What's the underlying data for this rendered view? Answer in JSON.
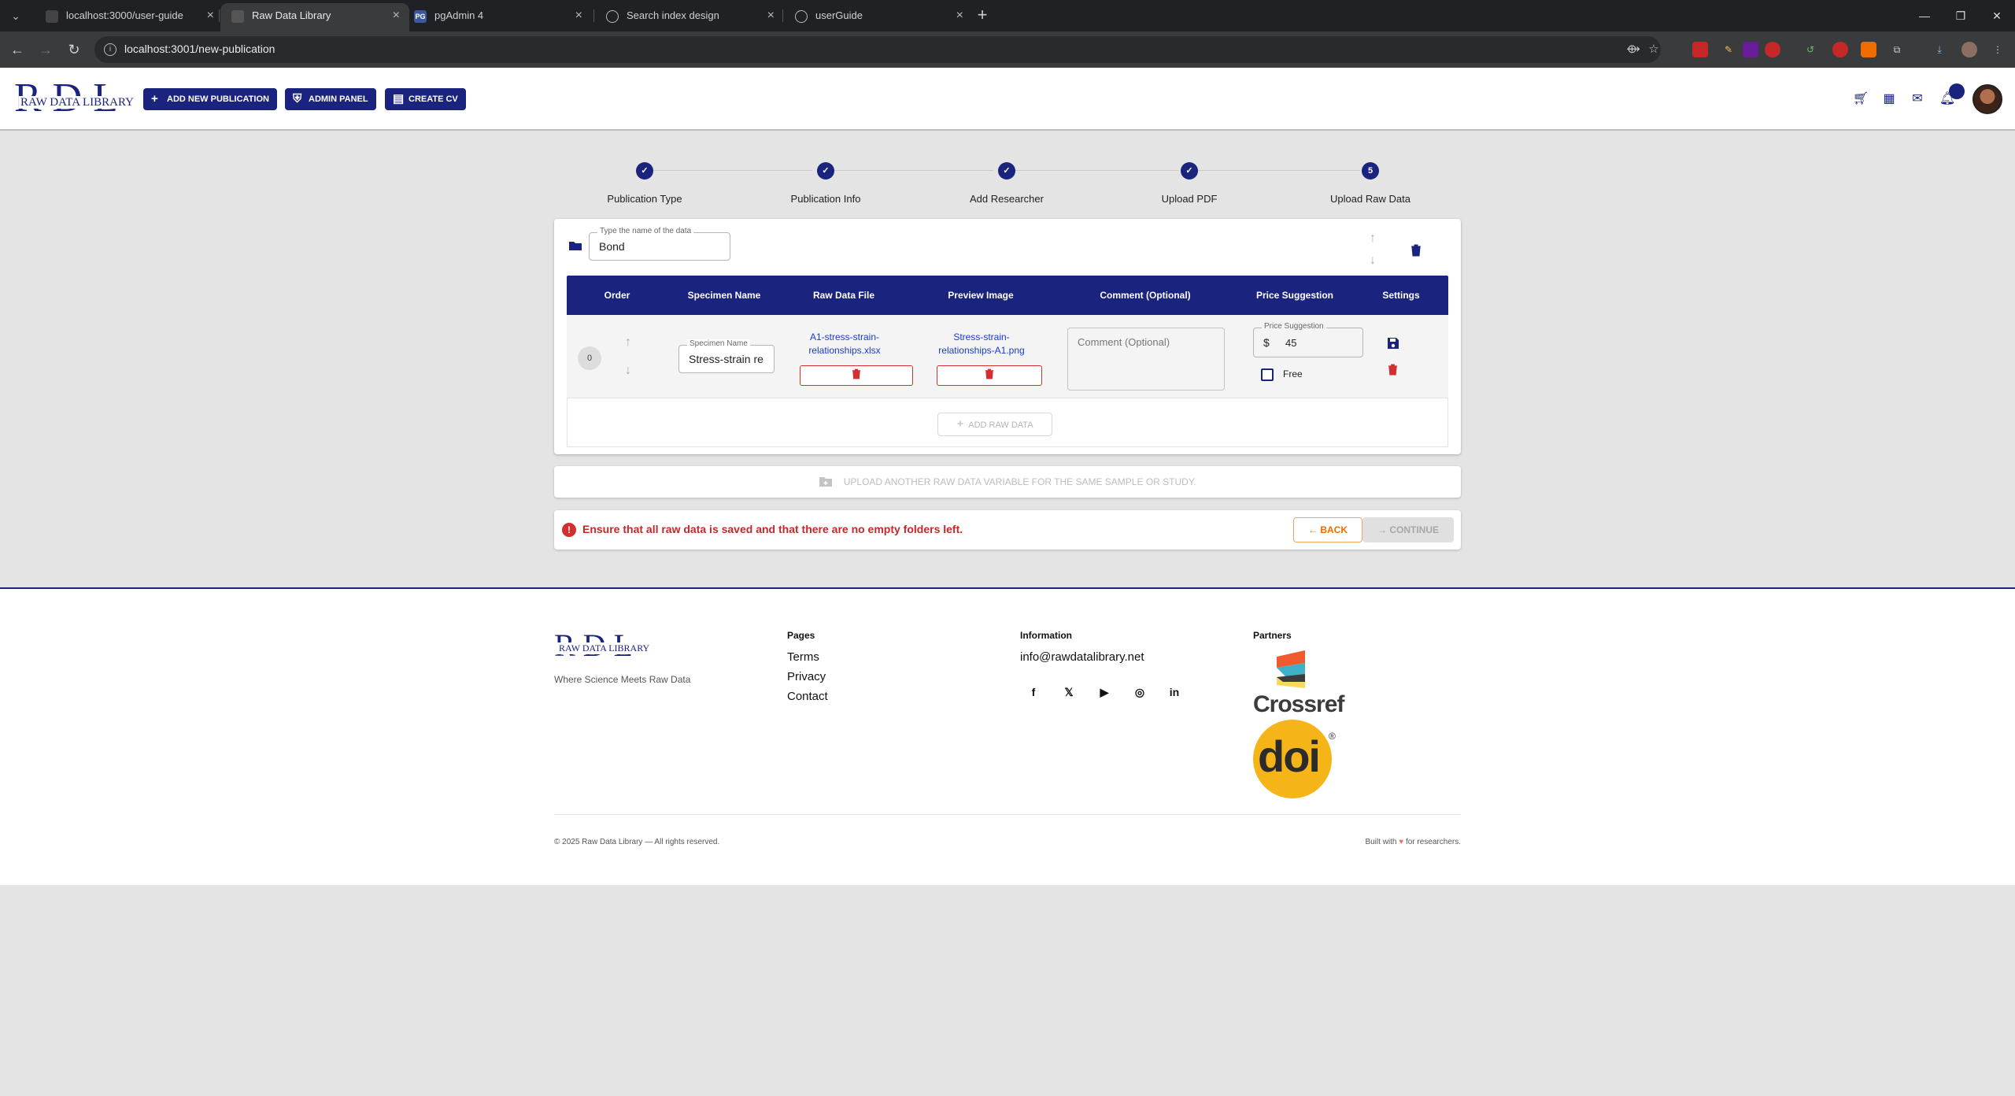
{
  "browser": {
    "tabs": [
      {
        "title": "localhost:3000/user-guide",
        "favicon_color": "#444"
      },
      {
        "title": "Raw Data Library",
        "favicon_color": "#555"
      },
      {
        "title": "pgAdmin 4",
        "favicon_color": "#3b5998"
      },
      {
        "title": "Search index design",
        "favicon_color": "#555"
      },
      {
        "title": "userGuide",
        "favicon_color": "#555"
      }
    ],
    "url": "localhost:3001/new-publication"
  },
  "header": {
    "logo_big": "RDL",
    "logo_small": "RAW DATA LIBRARY",
    "buttons": [
      {
        "label": "ADD NEW PUBLICATION",
        "icon": "plus-icon"
      },
      {
        "label": "ADMIN PANEL",
        "icon": "admin-shield-icon"
      },
      {
        "label": "CREATE CV",
        "icon": "cv-icon"
      }
    ]
  },
  "stepper": {
    "steps": [
      {
        "label": "Publication Type",
        "state": "done"
      },
      {
        "label": "Publication Info",
        "state": "done"
      },
      {
        "label": "Add Researcher",
        "state": "done"
      },
      {
        "label": "Upload PDF",
        "state": "done"
      },
      {
        "label": "Upload Raw Data",
        "state": "active",
        "number": "5"
      }
    ]
  },
  "folder": {
    "name_label": "Type the name of the data",
    "name_value": "Bond"
  },
  "table": {
    "headers": [
      "Order",
      "Specimen Name",
      "Raw Data File",
      "Preview Image",
      "Comment (Optional)",
      "Price Suggestion",
      "Settings"
    ],
    "row": {
      "order": "0",
      "specimen_label": "Specimen Name",
      "specimen_value": "Stress-strain re",
      "raw_file_line1": "A1-stress-strain-",
      "raw_file_line2": "relationships.xlsx",
      "preview_line1": "Stress-strain-",
      "preview_line2": "relationships-A1.png",
      "comment_placeholder": "Comment (Optional)",
      "price_label": "Price Suggestion",
      "price_currency": "$",
      "price_value": "45",
      "free_label": "Free",
      "free_checked": false
    },
    "add_raw_data": "ADD RAW DATA"
  },
  "upload_another": "UPLOAD ANOTHER RAW DATA VARIABLE FOR THE SAME SAMPLE OR STUDY.",
  "alert": {
    "message": "Ensure that all raw data is saved and that there are no empty folders left.",
    "back": "BACK",
    "continue": "CONTINUE"
  },
  "footer": {
    "logo_big": "RDL",
    "logo_small": "RAW DATA LIBRARY",
    "tagline": "Where Science Meets Raw Data",
    "pages_heading": "Pages",
    "pages": [
      "Terms",
      "Privacy",
      "Contact"
    ],
    "info_heading": "Information",
    "email": "info@rawdatalibrary.net",
    "social": [
      "facebook-icon",
      "x-icon",
      "youtube-icon",
      "instagram-icon",
      "linkedin-icon"
    ],
    "partners_heading": "Partners",
    "partner_crossref": "Crossref",
    "partner_doi": "doi",
    "copyright": "© 2025 Raw Data Library — All rights reserved.",
    "built_prefix": "Built with",
    "built_suffix": "for researchers."
  },
  "colors": {
    "primary": "#1a237e",
    "danger": "#d32f2f",
    "warning": "#ef6c00"
  }
}
